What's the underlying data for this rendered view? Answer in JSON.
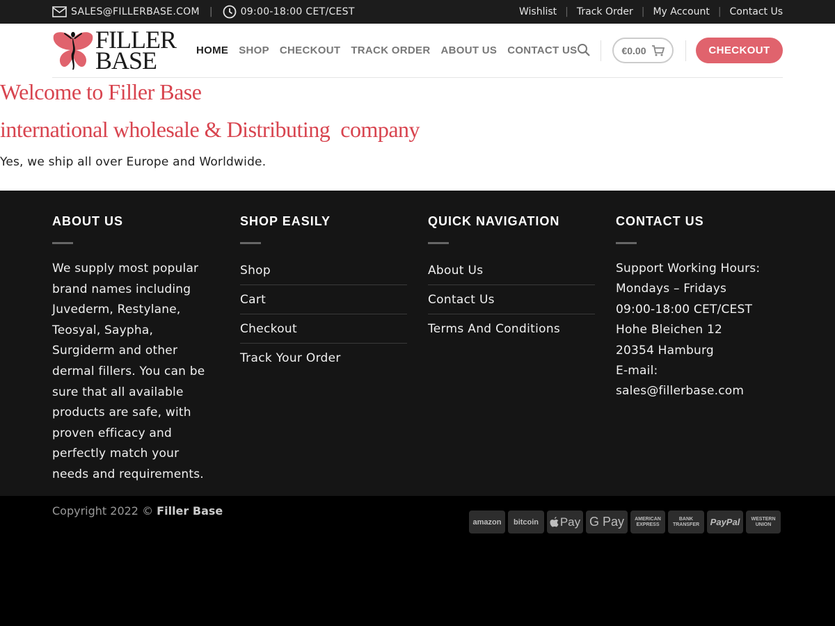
{
  "topbar": {
    "email": "SALES@FILLERBASE.COM",
    "hours": "09:00-18:00 CET/CEST",
    "links": [
      "Wishlist",
      "Track Order",
      "My Account",
      "Contact Us"
    ]
  },
  "header": {
    "logo_line1": "FILLER",
    "logo_line2": "BASE",
    "nav": [
      "HOME",
      "SHOP",
      "CHECKOUT",
      "TRACK ORDER",
      "ABOUT US",
      "CONTACT US"
    ],
    "cart_total": "€0.00",
    "checkout_label": "CHECKOUT"
  },
  "main": {
    "title": "Welcome to Filler Base",
    "subtitle": "international wholesale & Distributing  company",
    "text": "Yes, we ship all over Europe and Worldwide."
  },
  "footer": {
    "about": {
      "heading": "ABOUT US",
      "text": "We supply most popular brand names including Juvederm, Restylane, Teosyal, Saypha, Surgiderm and other dermal fillers. You can be sure that all available products are safe, with proven efficacy and perfectly match your needs and requirements."
    },
    "shop": {
      "heading": "SHOP EASILY",
      "links": [
        "Shop",
        "Cart",
        "Checkout",
        "Track Your Order"
      ]
    },
    "nav": {
      "heading": "QUICK NAVIGATION",
      "links": [
        "About Us",
        "Contact Us",
        "Terms And Conditions"
      ]
    },
    "contact": {
      "heading": "CONTACT US",
      "lines": [
        "Support Working Hours:",
        "Mondays – Fridays",
        "09:00-18:00 CET/CEST",
        "Hohe Bleichen 12",
        "20354 Hamburg",
        "E-mail: sales@fillerbase.com"
      ]
    }
  },
  "bottom": {
    "copyright_prefix": "Copyright 2022 ©",
    "copyright_brand": "Filler Base",
    "payments": [
      "amazon",
      "bitcoin",
      "Pay",
      "G Pay",
      "AMERICAN EXPRESS",
      "BANK TRANSFER",
      "PayPal",
      "WESTERN UNION"
    ]
  },
  "colors": {
    "accent": "#d8444f",
    "button": "#e0636d",
    "topbar": "#1c1c1c",
    "footer": "#151515"
  }
}
